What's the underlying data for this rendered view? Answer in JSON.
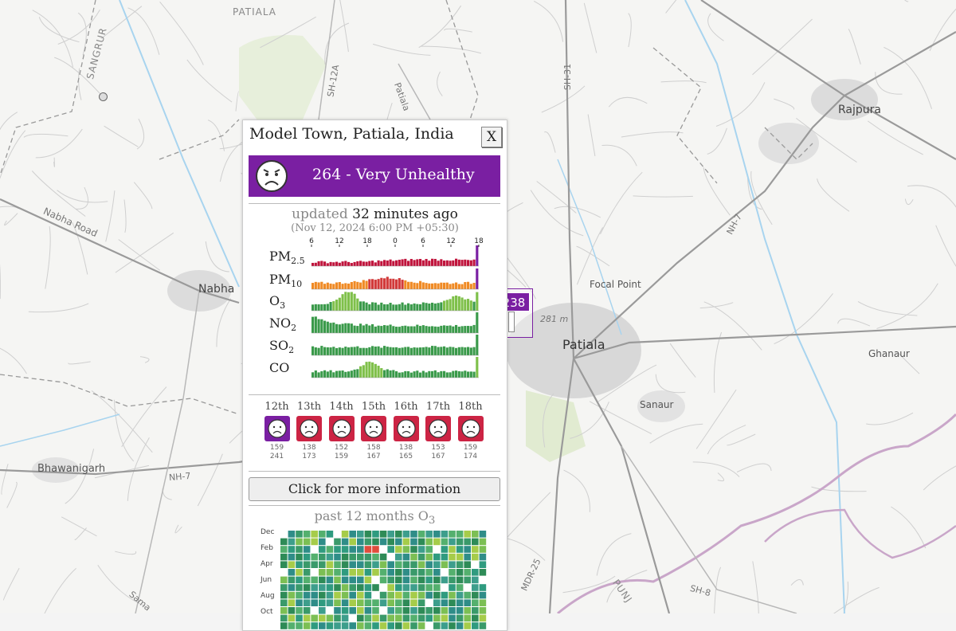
{
  "map": {
    "labels": {
      "patiala_top": "PATIALA",
      "sangrur": "SANGRUR",
      "nabha_road": "Nabha Road",
      "nabha": "Nabha",
      "sh12a": "SH-12A",
      "patiala_road": "Patiala",
      "sh31": "SH-31",
      "rajpura": "Rajpura",
      "nh7_ne": "NH-7",
      "focal_point": "Focal Point",
      "distance": "281 m",
      "patiala": "Patiala",
      "ghanaur": "Ghanaur",
      "sanaur": "Sanaur",
      "bhawanigarh": "Bhawanigarh",
      "nh7_w": "NH-7",
      "mdr25": "MDR-25",
      "punj": "PUNJ",
      "sh8": "SH-8",
      "sama": "Sama"
    },
    "marker": {
      "value": "238",
      "color": "#7a1fa2"
    }
  },
  "popup": {
    "station_name": "Model Town, Patiala, India",
    "close_label": "X",
    "aqi": {
      "value": 264,
      "category": "Very Unhealthy",
      "text": "264 - Very Unhealthy",
      "color": "#7a1fa2",
      "face": "unhappy-face-icon"
    },
    "updated_prefix": "updated",
    "updated_ago": "32 minutes ago",
    "updated_date": "(Nov 12, 2024 6:00 PM +05:30)",
    "history_chart": {
      "hour_ticks": [
        "6",
        "12",
        "18",
        "0",
        "6",
        "12",
        "18"
      ],
      "pollutants": [
        {
          "key": "pm25",
          "name": "PM",
          "sub": "2.5",
          "colors": [
            "#c0143c",
            "#7a1fa2"
          ],
          "shape": "flat-rising",
          "base": 0.2,
          "peak": 0.32,
          "last": 1.0
        },
        {
          "key": "pm10",
          "name": "PM",
          "sub": "10",
          "colors": [
            "#f08a24",
            "#d23a3a",
            "#7a1fa2"
          ],
          "shape": "hump",
          "base": 0.3,
          "peak": 0.55,
          "last": 1.0
        },
        {
          "key": "o3",
          "name": "O",
          "sub": "3",
          "colors": [
            "#3a9a4a",
            "#7fc04a"
          ],
          "shape": "double-hump",
          "base": 0.35,
          "peak": 0.95,
          "last": 0.9
        },
        {
          "key": "no2",
          "name": "NO",
          "sub": "2",
          "colors": [
            "#3a9a4a"
          ],
          "shape": "decay",
          "base": 0.35,
          "peak": 0.8,
          "last": 1.0
        },
        {
          "key": "so2",
          "name": "SO",
          "sub": "2",
          "colors": [
            "#3a9a4a"
          ],
          "shape": "noisy",
          "base": 0.4,
          "peak": 0.6,
          "last": 1.0
        },
        {
          "key": "co",
          "name": "CO",
          "sub": "",
          "colors": [
            "#3a9a4a",
            "#7fc04a"
          ],
          "shape": "midhump",
          "base": 0.3,
          "peak": 0.85,
          "last": 1.0
        }
      ]
    },
    "forecast": [
      {
        "day": "12th",
        "color": "#7a1fa2",
        "low": "159",
        "high": "241"
      },
      {
        "day": "13th",
        "color": "#cc2444",
        "low": "138",
        "high": "173"
      },
      {
        "day": "14th",
        "color": "#cc2444",
        "low": "152",
        "high": "159"
      },
      {
        "day": "15th",
        "color": "#cc2444",
        "low": "158",
        "high": "167"
      },
      {
        "day": "16th",
        "color": "#cc2444",
        "low": "138",
        "high": "165"
      },
      {
        "day": "17th",
        "color": "#cc2444",
        "low": "153",
        "high": "167"
      },
      {
        "day": "18th",
        "color": "#cc2444",
        "low": "159",
        "high": "174"
      }
    ],
    "more_info_label": "Click for more information",
    "past_title_prefix": "past 12 months O",
    "past_title_sub": "3",
    "past_calendar": {
      "month_labels": [
        "Dec",
        "Feb",
        "Apr",
        "Jun",
        "Aug",
        "Oct"
      ]
    }
  }
}
